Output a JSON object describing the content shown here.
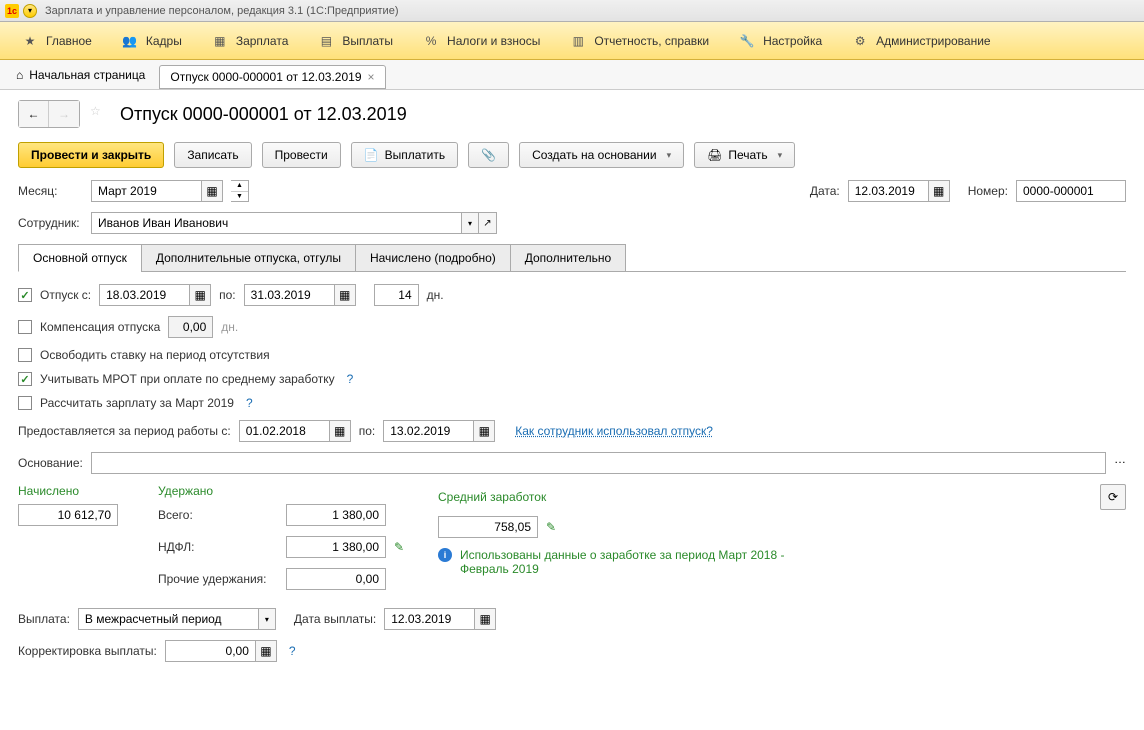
{
  "window_title": "Зарплата и управление персоналом, редакция 3.1  (1С:Предприятие)",
  "main_menu": [
    {
      "label": "Главное",
      "icon": "star"
    },
    {
      "label": "Кадры",
      "icon": "people"
    },
    {
      "label": "Зарплата",
      "icon": "calc"
    },
    {
      "label": "Выплаты",
      "icon": "wallet"
    },
    {
      "label": "Налоги и взносы",
      "icon": "percent"
    },
    {
      "label": "Отчетность, справки",
      "icon": "report"
    },
    {
      "label": "Настройка",
      "icon": "wrench"
    },
    {
      "label": "Администрирование",
      "icon": "gear"
    }
  ],
  "home_tab": "Начальная страница",
  "tab_label": "Отпуск 0000-000001 от 12.03.2019",
  "page_title": "Отпуск 0000-000001 от 12.03.2019",
  "toolbar": {
    "post_close": "Провести и закрыть",
    "save": "Записать",
    "post": "Провести",
    "pay": "Выплатить",
    "create_based": "Создать на основании",
    "print": "Печать"
  },
  "labels": {
    "month": "Месяц:",
    "date": "Дата:",
    "number": "Номер:",
    "employee": "Сотрудник:",
    "vacation_from": "Отпуск  с:",
    "to": "по:",
    "days": "дн.",
    "compensation": "Компенсация отпуска",
    "free_rate": "Освободить ставку на период отсутствия",
    "mrot": "Учитывать МРОТ при оплате по среднему заработку",
    "calc_salary": "Рассчитать зарплату за Март 2019",
    "period_work": "Предоставляется за период работы с:",
    "how_used": "Как сотрудник использовал отпуск?",
    "basis": "Основание:",
    "accrued": "Начислено",
    "withheld": "Удержано",
    "avg_earnings": "Средний заработок",
    "total": "Всего:",
    "ndfl": "НДФЛ:",
    "other_withhold": "Прочие удержания:",
    "info_text": "Использованы данные о заработке за период Март 2018 - Февраль 2019",
    "payment": "Выплата:",
    "payment_date": "Дата выплаты:",
    "correction": "Корректировка выплаты:"
  },
  "values": {
    "month": "Март 2019",
    "date": "12.03.2019",
    "number": "0000-000001",
    "employee": "Иванов Иван Иванович",
    "vac_from": "18.03.2019",
    "vac_to": "31.03.2019",
    "vac_days": "14",
    "comp_days": "0,00",
    "period_from": "01.02.2018",
    "period_to": "13.02.2019",
    "basis": "",
    "accrued": "10 612,70",
    "total_withheld": "1 380,00",
    "ndfl": "1 380,00",
    "other": "0,00",
    "avg": "758,05",
    "payment_mode": "В межрасчетный период",
    "payment_date": "12.03.2019",
    "correction": "0,00"
  },
  "tabs": [
    "Основной отпуск",
    "Дополнительные отпуска, отгулы",
    "Начислено (подробно)",
    "Дополнительно"
  ]
}
